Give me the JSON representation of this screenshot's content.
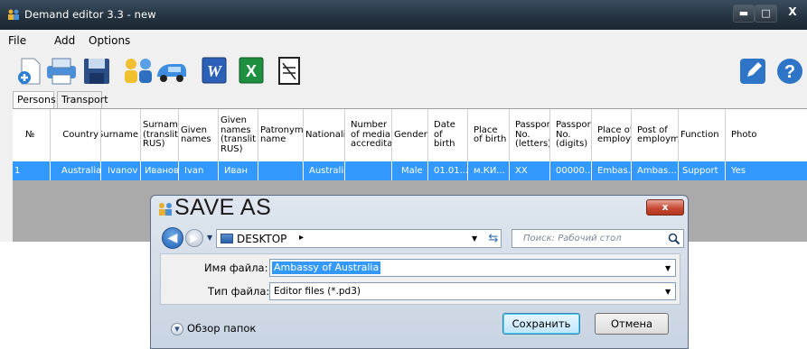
{
  "window": {
    "title": "Demand editor 3.3 - new",
    "buttons": {
      "minimize": "▬",
      "maximize": "□",
      "close": "X"
    }
  },
  "menu": [
    "File",
    "Add",
    "Options"
  ],
  "toolbar": {
    "icons": [
      "new-icon",
      "print-icon",
      "save-icon",
      "persons-icon",
      "transport-icon",
      "word-icon",
      "excel-icon",
      "notepad-icon",
      "edit-icon",
      "help-icon"
    ]
  },
  "tabs": [
    "Persons",
    "Transport"
  ],
  "grid": {
    "columns": [
      "№",
      "Country",
      "Surname",
      "Surname (translit RUS)",
      "Given names",
      "Given names (translit RUS)",
      "Patronym name",
      "Nationalit",
      "Number of media accredita",
      "Gender",
      "Date of birth",
      "Place of birth",
      "Passport No. (letters)",
      "Passport No. (digits)",
      "Place of employm",
      "Post of employm",
      "Function",
      "Photo"
    ],
    "rows": [
      [
        "1",
        "Australia",
        "Ivanov",
        "Иванов",
        "Ivan",
        "Иван",
        "",
        "Australia",
        "",
        "Male",
        "01.01....",
        "м.КИ...",
        "XX",
        "00000...",
        "Embas...",
        "Ambas...",
        "Support",
        "Yes"
      ]
    ]
  },
  "dialog": {
    "title": "SAVE AS",
    "close": "x",
    "path": "DESKTOP",
    "search_placeholder": "Поиск: Рабочий стол",
    "filename_label": "Имя файла:",
    "filename_value": "Ambassy of Australia",
    "filetype_label": "Тип файла:",
    "filetype_value": "Editor files (*.pd3)",
    "browse_label": "Обзор папок",
    "save_label": "Сохранить",
    "cancel_label": "Отмена"
  },
  "colors": {
    "titlebar": "#24323f",
    "selection": "#3399ff",
    "grid_empty": "#aaaaaa"
  }
}
